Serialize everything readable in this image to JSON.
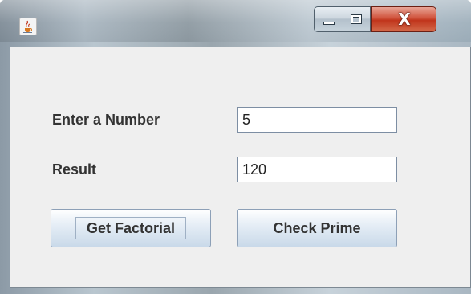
{
  "window": {
    "icon": "java-cup-icon",
    "controls": {
      "minimize": "minimize-icon",
      "maximize": "maximize-icon",
      "close": "X"
    }
  },
  "form": {
    "number_label": "Enter a Number",
    "number_value": "5",
    "result_label": "Result",
    "result_value": "120"
  },
  "buttons": {
    "factorial_label": "Get Factorial",
    "prime_label": "Check Prime"
  },
  "colors": {
    "panel_bg": "#efefef",
    "close_red": "#c0341b"
  }
}
